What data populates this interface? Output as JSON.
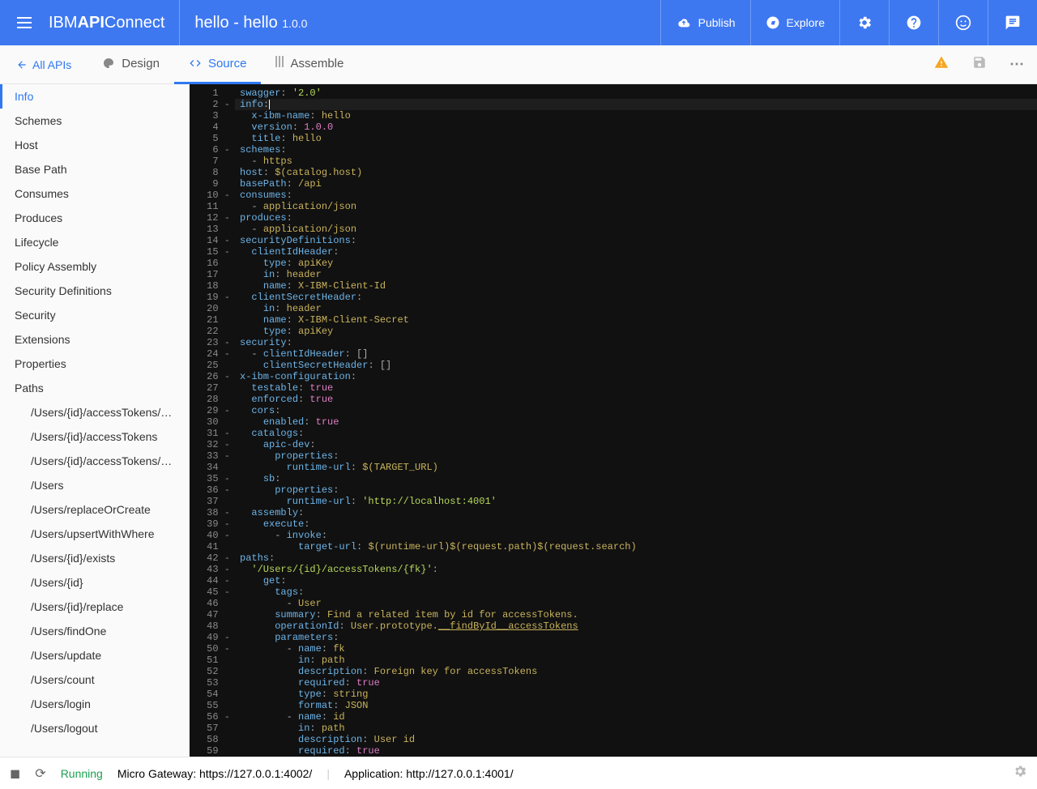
{
  "brand": {
    "pre": "IBM ",
    "bold": "API",
    "post": " Connect"
  },
  "pageTitle": "hello - hello",
  "version": "1.0.0",
  "headerActions": {
    "publish": "Publish",
    "explore": "Explore"
  },
  "back": "All APIs",
  "tabs": {
    "design": "Design",
    "source": "Source",
    "assemble": "Assemble"
  },
  "sidebar": [
    {
      "label": "Info",
      "active": true
    },
    {
      "label": "Schemes"
    },
    {
      "label": "Host"
    },
    {
      "label": "Base Path"
    },
    {
      "label": "Consumes"
    },
    {
      "label": "Produces"
    },
    {
      "label": "Lifecycle"
    },
    {
      "label": "Policy Assembly"
    },
    {
      "label": "Security Definitions"
    },
    {
      "label": "Security"
    },
    {
      "label": "Extensions"
    },
    {
      "label": "Properties"
    },
    {
      "label": "Paths"
    },
    {
      "label": "/Users/{id}/accessTokens/{fk}",
      "sub": true
    },
    {
      "label": "/Users/{id}/accessTokens",
      "sub": true
    },
    {
      "label": "/Users/{id}/accessTokens/co...",
      "sub": true
    },
    {
      "label": "/Users",
      "sub": true
    },
    {
      "label": "/Users/replaceOrCreate",
      "sub": true
    },
    {
      "label": "/Users/upsertWithWhere",
      "sub": true
    },
    {
      "label": "/Users/{id}/exists",
      "sub": true
    },
    {
      "label": "/Users/{id}",
      "sub": true
    },
    {
      "label": "/Users/{id}/replace",
      "sub": true
    },
    {
      "label": "/Users/findOne",
      "sub": true
    },
    {
      "label": "/Users/update",
      "sub": true
    },
    {
      "label": "/Users/count",
      "sub": true
    },
    {
      "label": "/Users/login",
      "sub": true
    },
    {
      "label": "/Users/logout",
      "sub": true
    }
  ],
  "code": [
    {
      "n": 1,
      "f": "",
      "t": [
        [
          "k",
          "swagger"
        ],
        [
          "p",
          ": "
        ],
        [
          "s",
          "'2.0'"
        ]
      ]
    },
    {
      "n": 2,
      "f": "-",
      "cursor": true,
      "t": [
        [
          "k",
          "info"
        ],
        [
          "p",
          ":"
        ]
      ]
    },
    {
      "n": 3,
      "f": "",
      "t": [
        [
          "p",
          "  "
        ],
        [
          "k",
          "x-ibm-name"
        ],
        [
          "p",
          ": "
        ],
        [
          "v",
          "hello"
        ]
      ]
    },
    {
      "n": 4,
      "f": "",
      "t": [
        [
          "p",
          "  "
        ],
        [
          "k",
          "version"
        ],
        [
          "p",
          ": "
        ],
        [
          "n",
          "1.0.0"
        ]
      ]
    },
    {
      "n": 5,
      "f": "",
      "t": [
        [
          "p",
          "  "
        ],
        [
          "k",
          "title"
        ],
        [
          "p",
          ": "
        ],
        [
          "v",
          "hello"
        ]
      ]
    },
    {
      "n": 6,
      "f": "-",
      "t": [
        [
          "k",
          "schemes"
        ],
        [
          "p",
          ":"
        ]
      ]
    },
    {
      "n": 7,
      "f": "",
      "t": [
        [
          "p",
          "  - "
        ],
        [
          "v",
          "https"
        ]
      ]
    },
    {
      "n": 8,
      "f": "",
      "t": [
        [
          "k",
          "host"
        ],
        [
          "p",
          ": "
        ],
        [
          "v",
          "$(catalog.host)"
        ]
      ]
    },
    {
      "n": 9,
      "f": "",
      "t": [
        [
          "k",
          "basePath"
        ],
        [
          "p",
          ": "
        ],
        [
          "v",
          "/api"
        ]
      ]
    },
    {
      "n": 10,
      "f": "-",
      "t": [
        [
          "k",
          "consumes"
        ],
        [
          "p",
          ":"
        ]
      ]
    },
    {
      "n": 11,
      "f": "",
      "t": [
        [
          "p",
          "  - "
        ],
        [
          "v",
          "application/json"
        ]
      ]
    },
    {
      "n": 12,
      "f": "-",
      "t": [
        [
          "k",
          "produces"
        ],
        [
          "p",
          ":"
        ]
      ]
    },
    {
      "n": 13,
      "f": "",
      "t": [
        [
          "p",
          "  - "
        ],
        [
          "v",
          "application/json"
        ]
      ]
    },
    {
      "n": 14,
      "f": "-",
      "t": [
        [
          "k",
          "securityDefinitions"
        ],
        [
          "p",
          ":"
        ]
      ]
    },
    {
      "n": 15,
      "f": "-",
      "t": [
        [
          "p",
          "  "
        ],
        [
          "k",
          "clientIdHeader"
        ],
        [
          "p",
          ":"
        ]
      ]
    },
    {
      "n": 16,
      "f": "",
      "t": [
        [
          "p",
          "    "
        ],
        [
          "k",
          "type"
        ],
        [
          "p",
          ": "
        ],
        [
          "v",
          "apiKey"
        ]
      ]
    },
    {
      "n": 17,
      "f": "",
      "t": [
        [
          "p",
          "    "
        ],
        [
          "k",
          "in"
        ],
        [
          "p",
          ": "
        ],
        [
          "v",
          "header"
        ]
      ]
    },
    {
      "n": 18,
      "f": "",
      "t": [
        [
          "p",
          "    "
        ],
        [
          "k",
          "name"
        ],
        [
          "p",
          ": "
        ],
        [
          "v",
          "X-IBM-Client-Id"
        ]
      ]
    },
    {
      "n": 19,
      "f": "-",
      "t": [
        [
          "p",
          "  "
        ],
        [
          "k",
          "clientSecretHeader"
        ],
        [
          "p",
          ":"
        ]
      ]
    },
    {
      "n": 20,
      "f": "",
      "t": [
        [
          "p",
          "    "
        ],
        [
          "k",
          "in"
        ],
        [
          "p",
          ": "
        ],
        [
          "v",
          "header"
        ]
      ]
    },
    {
      "n": 21,
      "f": "",
      "t": [
        [
          "p",
          "    "
        ],
        [
          "k",
          "name"
        ],
        [
          "p",
          ": "
        ],
        [
          "v",
          "X-IBM-Client-Secret"
        ]
      ]
    },
    {
      "n": 22,
      "f": "",
      "t": [
        [
          "p",
          "    "
        ],
        [
          "k",
          "type"
        ],
        [
          "p",
          ": "
        ],
        [
          "v",
          "apiKey"
        ]
      ]
    },
    {
      "n": 23,
      "f": "-",
      "t": [
        [
          "k",
          "security"
        ],
        [
          "p",
          ":"
        ]
      ]
    },
    {
      "n": 24,
      "f": "-",
      "t": [
        [
          "p",
          "  - "
        ],
        [
          "k",
          "clientIdHeader"
        ],
        [
          "p",
          ": []"
        ]
      ]
    },
    {
      "n": 25,
      "f": "",
      "t": [
        [
          "p",
          "    "
        ],
        [
          "k",
          "clientSecretHeader"
        ],
        [
          "p",
          ": []"
        ]
      ]
    },
    {
      "n": 26,
      "f": "-",
      "t": [
        [
          "k",
          "x-ibm-configuration"
        ],
        [
          "p",
          ":"
        ]
      ]
    },
    {
      "n": 27,
      "f": "",
      "t": [
        [
          "p",
          "  "
        ],
        [
          "k",
          "testable"
        ],
        [
          "p",
          ": "
        ],
        [
          "b",
          "true"
        ]
      ]
    },
    {
      "n": 28,
      "f": "",
      "t": [
        [
          "p",
          "  "
        ],
        [
          "k",
          "enforced"
        ],
        [
          "p",
          ": "
        ],
        [
          "b",
          "true"
        ]
      ]
    },
    {
      "n": 29,
      "f": "-",
      "t": [
        [
          "p",
          "  "
        ],
        [
          "k",
          "cors"
        ],
        [
          "p",
          ":"
        ]
      ]
    },
    {
      "n": 30,
      "f": "",
      "t": [
        [
          "p",
          "    "
        ],
        [
          "k",
          "enabled"
        ],
        [
          "p",
          ": "
        ],
        [
          "b",
          "true"
        ]
      ]
    },
    {
      "n": 31,
      "f": "-",
      "t": [
        [
          "p",
          "  "
        ],
        [
          "k",
          "catalogs"
        ],
        [
          "p",
          ":"
        ]
      ]
    },
    {
      "n": 32,
      "f": "-",
      "t": [
        [
          "p",
          "    "
        ],
        [
          "k",
          "apic-dev"
        ],
        [
          "p",
          ":"
        ]
      ]
    },
    {
      "n": 33,
      "f": "-",
      "t": [
        [
          "p",
          "      "
        ],
        [
          "k",
          "properties"
        ],
        [
          "p",
          ":"
        ]
      ]
    },
    {
      "n": 34,
      "f": "",
      "t": [
        [
          "p",
          "        "
        ],
        [
          "k",
          "runtime-url"
        ],
        [
          "p",
          ": "
        ],
        [
          "v",
          "$(TARGET_URL)"
        ]
      ]
    },
    {
      "n": 35,
      "f": "-",
      "t": [
        [
          "p",
          "    "
        ],
        [
          "k",
          "sb"
        ],
        [
          "p",
          ":"
        ]
      ]
    },
    {
      "n": 36,
      "f": "-",
      "t": [
        [
          "p",
          "      "
        ],
        [
          "k",
          "properties"
        ],
        [
          "p",
          ":"
        ]
      ]
    },
    {
      "n": 37,
      "f": "",
      "t": [
        [
          "p",
          "        "
        ],
        [
          "k",
          "runtime-url"
        ],
        [
          "p",
          ": "
        ],
        [
          "s",
          "'http://localhost:4001'"
        ]
      ]
    },
    {
      "n": 38,
      "f": "-",
      "t": [
        [
          "p",
          "  "
        ],
        [
          "k",
          "assembly"
        ],
        [
          "p",
          ":"
        ]
      ]
    },
    {
      "n": 39,
      "f": "-",
      "t": [
        [
          "p",
          "    "
        ],
        [
          "k",
          "execute"
        ],
        [
          "p",
          ":"
        ]
      ]
    },
    {
      "n": 40,
      "f": "-",
      "t": [
        [
          "p",
          "      - "
        ],
        [
          "k",
          "invoke"
        ],
        [
          "p",
          ":"
        ]
      ]
    },
    {
      "n": 41,
      "f": "",
      "t": [
        [
          "p",
          "          "
        ],
        [
          "k",
          "target-url"
        ],
        [
          "p",
          ": "
        ],
        [
          "v",
          "$(runtime-url)$(request.path)$(request.search)"
        ]
      ]
    },
    {
      "n": 42,
      "f": "-",
      "t": [
        [
          "k",
          "paths"
        ],
        [
          "p",
          ":"
        ]
      ]
    },
    {
      "n": 43,
      "f": "-",
      "t": [
        [
          "p",
          "  "
        ],
        [
          "s",
          "'/Users/{id}/accessTokens/{fk}'"
        ],
        [
          "p",
          ":"
        ]
      ]
    },
    {
      "n": 44,
      "f": "-",
      "t": [
        [
          "p",
          "    "
        ],
        [
          "k",
          "get"
        ],
        [
          "p",
          ":"
        ]
      ]
    },
    {
      "n": 45,
      "f": "-",
      "t": [
        [
          "p",
          "      "
        ],
        [
          "k",
          "tags"
        ],
        [
          "p",
          ":"
        ]
      ]
    },
    {
      "n": 46,
      "f": "",
      "t": [
        [
          "p",
          "        - "
        ],
        [
          "v",
          "User"
        ]
      ]
    },
    {
      "n": 47,
      "f": "",
      "t": [
        [
          "p",
          "      "
        ],
        [
          "k",
          "summary"
        ],
        [
          "p",
          ": "
        ],
        [
          "v",
          "Find a related item by id for accessTokens."
        ]
      ]
    },
    {
      "n": 48,
      "f": "",
      "t": [
        [
          "p",
          "      "
        ],
        [
          "k",
          "operationId"
        ],
        [
          "p",
          ": "
        ],
        [
          "v",
          "User.prototype."
        ],
        [
          "u",
          "__findById__accessTokens"
        ]
      ]
    },
    {
      "n": 49,
      "f": "-",
      "t": [
        [
          "p",
          "      "
        ],
        [
          "k",
          "parameters"
        ],
        [
          "p",
          ":"
        ]
      ]
    },
    {
      "n": 50,
      "f": "-",
      "t": [
        [
          "p",
          "        - "
        ],
        [
          "k",
          "name"
        ],
        [
          "p",
          ": "
        ],
        [
          "v",
          "fk"
        ]
      ]
    },
    {
      "n": 51,
      "f": "",
      "t": [
        [
          "p",
          "          "
        ],
        [
          "k",
          "in"
        ],
        [
          "p",
          ": "
        ],
        [
          "v",
          "path"
        ]
      ]
    },
    {
      "n": 52,
      "f": "",
      "t": [
        [
          "p",
          "          "
        ],
        [
          "k",
          "description"
        ],
        [
          "p",
          ": "
        ],
        [
          "v",
          "Foreign key for accessTokens"
        ]
      ]
    },
    {
      "n": 53,
      "f": "",
      "t": [
        [
          "p",
          "          "
        ],
        [
          "k",
          "required"
        ],
        [
          "p",
          ": "
        ],
        [
          "b",
          "true"
        ]
      ]
    },
    {
      "n": 54,
      "f": "",
      "t": [
        [
          "p",
          "          "
        ],
        [
          "k",
          "type"
        ],
        [
          "p",
          ": "
        ],
        [
          "v",
          "string"
        ]
      ]
    },
    {
      "n": 55,
      "f": "",
      "t": [
        [
          "p",
          "          "
        ],
        [
          "k",
          "format"
        ],
        [
          "p",
          ": "
        ],
        [
          "v",
          "JSON"
        ]
      ]
    },
    {
      "n": 56,
      "f": "-",
      "t": [
        [
          "p",
          "        - "
        ],
        [
          "k",
          "name"
        ],
        [
          "p",
          ": "
        ],
        [
          "v",
          "id"
        ]
      ]
    },
    {
      "n": 57,
      "f": "",
      "t": [
        [
          "p",
          "          "
        ],
        [
          "k",
          "in"
        ],
        [
          "p",
          ": "
        ],
        [
          "v",
          "path"
        ]
      ]
    },
    {
      "n": 58,
      "f": "",
      "t": [
        [
          "p",
          "          "
        ],
        [
          "k",
          "description"
        ],
        [
          "p",
          ": "
        ],
        [
          "v",
          "User id"
        ]
      ]
    },
    {
      "n": 59,
      "f": "",
      "t": [
        [
          "p",
          "          "
        ],
        [
          "k",
          "required"
        ],
        [
          "p",
          ": "
        ],
        [
          "b",
          "true"
        ]
      ]
    }
  ],
  "footer": {
    "running": "Running",
    "gw_label": "Micro Gateway: ",
    "gw_url": "https://127.0.0.1:4002/",
    "app_label": "Application: ",
    "app_url": "http://127.0.0.1:4001/"
  }
}
